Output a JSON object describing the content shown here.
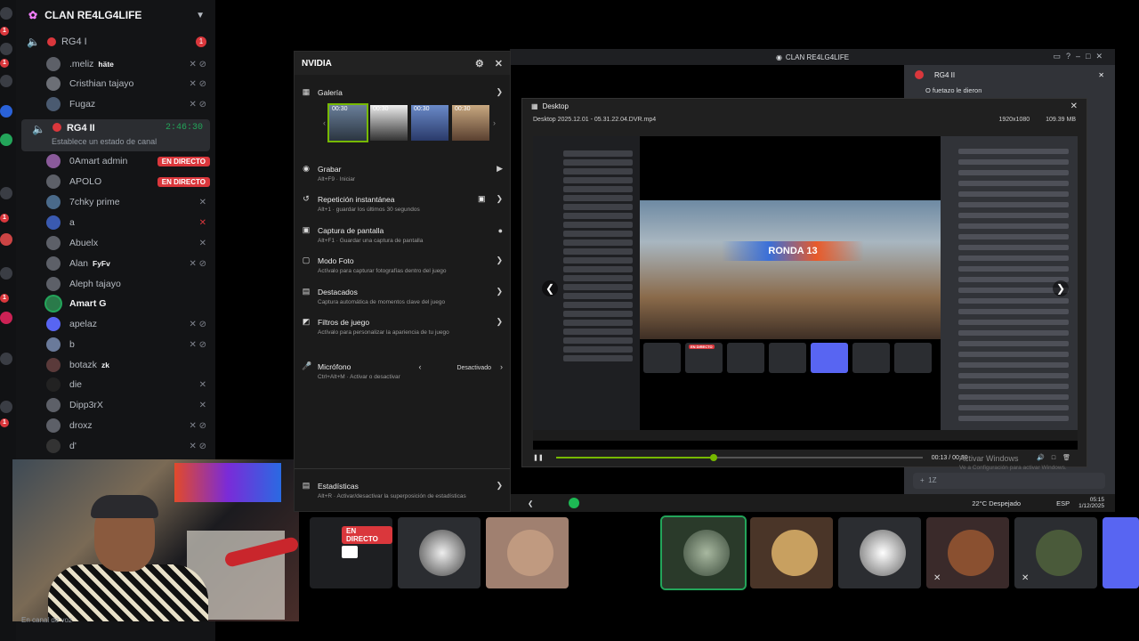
{
  "sidebar": {
    "server_name": "CLAN RE4LG4LIFE",
    "channels": [
      {
        "name": "RG4 I",
        "badge": "1"
      },
      {
        "name": "RG4 II",
        "timer": "2:46:30",
        "status": "Establece un estado de canal"
      }
    ],
    "members_rg4i": [
      {
        "name": ".meliz",
        "tag": "häte"
      },
      {
        "name": "Cristhian tajayo"
      },
      {
        "name": "Fugaz"
      }
    ],
    "members_rg4ii": [
      {
        "name": "0Amart admin",
        "live": "EN DIRECTO"
      },
      {
        "name": "APOLO",
        "live": "EN DIRECTO"
      },
      {
        "name": "7chky prime"
      },
      {
        "name": "a"
      },
      {
        "name": "Abuelx"
      },
      {
        "name": "Alan",
        "tag": "FyFv"
      },
      {
        "name": "Aleph tajayo"
      },
      {
        "name": "Amart G"
      },
      {
        "name": "apelaz"
      },
      {
        "name": "b"
      },
      {
        "name": "botazk",
        "tag": "zk"
      },
      {
        "name": "die"
      },
      {
        "name": "Dipp3rX"
      },
      {
        "name": "droxz"
      },
      {
        "name": "d'"
      }
    ],
    "voice_footer": "En canal de voz"
  },
  "back_window": {
    "title": "CLAN RE4LG4LIFE",
    "chat_header": "RG4 II",
    "chat_message": "O fuetazo le dieron",
    "taskbar": {
      "weather": "22°C Despejado",
      "time": "05:15",
      "date": "1/12/2025",
      "lang": "ESP"
    }
  },
  "nvidia": {
    "title": "NVIDIA",
    "gallery": {
      "label": "Galería",
      "thumbs": [
        "00:30",
        "00:30",
        "00:30",
        "00:30"
      ]
    },
    "items": [
      {
        "icon": "record-icon",
        "glyph": "▶",
        "title": "Grabar",
        "sub": "Alt+F9 · Iniciar"
      },
      {
        "icon": "replay-icon",
        "glyph": "↺",
        "title": "Repetición instantánea",
        "sub": "Alt+1 · guardar los últimos 30 segundos"
      },
      {
        "icon": "screenshot-icon",
        "glyph": "▣",
        "title": "Captura de pantalla",
        "sub": "Alt+F1 · Guardar una captura de pantalla"
      },
      {
        "icon": "photo-mode-icon",
        "glyph": "▢",
        "title": "Modo Foto",
        "sub": "Actívalo para capturar fotografías dentro del juego"
      },
      {
        "icon": "highlights-icon",
        "glyph": "▤",
        "title": "Destacados",
        "sub": "Captura automática de momentos clave del juego"
      },
      {
        "icon": "filters-icon",
        "glyph": "◩",
        "title": "Filtros de juego",
        "sub": "Actívalo para personalizar la apariencia de tu juego"
      }
    ],
    "mic": {
      "title": "Micrófono",
      "sub": "Ctrl+Alt+M · Activar o desactivar",
      "state": "Desactivado"
    },
    "stats": {
      "title": "Estadísticas",
      "sub": "Alt+R · Activar/desactivar la superposición de estadísticas"
    }
  },
  "player": {
    "title": "Desktop",
    "file": "Desktop 2025.12.01 - 05.31.22.04.DVR.mp4",
    "resolution": "1920x1080",
    "size": "109.39 MB",
    "time": "00:13 / 00:30",
    "progress": 0.43,
    "inner": {
      "banner": "RONDA 13",
      "live": "EN DIRECTO"
    }
  },
  "watermark": {
    "title": "Activar Windows",
    "sub": "Ve a Configuración para activar Windows."
  },
  "strip": {
    "live": "EN DIRECTO"
  },
  "colors": {
    "live": "#da373c",
    "connected": "#23a55a",
    "nvidia_green": "#76b900",
    "blurple": "#5865f2"
  }
}
